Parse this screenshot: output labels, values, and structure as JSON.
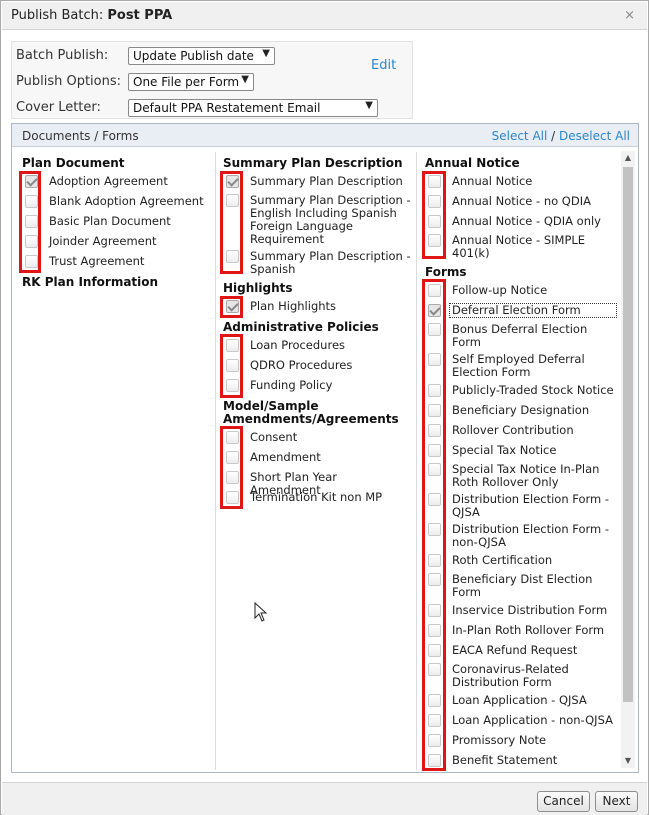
{
  "dialog": {
    "title_prefix": "Publish Batch:",
    "title_name": "Post PPA",
    "close": "×"
  },
  "options": {
    "batch_publish_label": "Batch Publish:",
    "batch_publish_value": "Update Publish date",
    "publish_options_label": "Publish Options:",
    "publish_options_value": "One File per Form",
    "cover_letter_label": "Cover Letter:",
    "cover_letter_value": "Default PPA Restatement Email",
    "edit_label": "Edit"
  },
  "panel": {
    "title": "Documents / Forms",
    "select_all": "Select All",
    "separator": "/",
    "deselect_all": "Deselect All"
  },
  "col1": {
    "plan_document": "Plan Document",
    "items": [
      {
        "label": "Adoption Agreement",
        "checked": true
      },
      {
        "label": "Blank Adoption Agreement",
        "checked": false
      },
      {
        "label": "Basic Plan Document",
        "checked": false
      },
      {
        "label": "Joinder Agreement",
        "checked": false
      },
      {
        "label": "Trust Agreement",
        "checked": false
      }
    ],
    "rk_plan_info": "RK Plan Information"
  },
  "col2": {
    "spd": "Summary Plan Description",
    "spd_items": [
      {
        "label": "Summary Plan Description",
        "checked": true
      },
      {
        "label": "Summary Plan Description - English Including Spanish Foreign Language Requirement",
        "checked": false
      },
      {
        "label": "Summary Plan Description - Spanish",
        "checked": false
      }
    ],
    "highlights": "Highlights",
    "highlights_items": [
      {
        "label": "Plan Highlights",
        "checked": true
      }
    ],
    "admin": "Administrative Policies",
    "admin_items": [
      {
        "label": "Loan Procedures",
        "checked": false
      },
      {
        "label": "QDRO Procedures",
        "checked": false
      },
      {
        "label": "Funding Policy",
        "checked": false
      }
    ],
    "model": "Model/Sample Amendments/Agreements",
    "model_items": [
      {
        "label": "Consent",
        "checked": false
      },
      {
        "label": "Amendment",
        "checked": false
      },
      {
        "label": "Short Plan Year Amendment",
        "checked": false
      },
      {
        "label": "Termination Kit non MP",
        "checked": false
      }
    ]
  },
  "col3": {
    "annual": "Annual Notice",
    "annual_items": [
      {
        "label": "Annual Notice",
        "checked": false
      },
      {
        "label": "Annual Notice - no QDIA",
        "checked": false
      },
      {
        "label": "Annual Notice - QDIA only",
        "checked": false
      },
      {
        "label": "Annual Notice - SIMPLE 401(k)",
        "checked": false
      }
    ],
    "forms": "Forms",
    "forms_items": [
      {
        "label": "Follow-up Notice",
        "checked": false
      },
      {
        "label": "Deferral Election Form",
        "checked": true
      },
      {
        "label": "Bonus Deferral Election Form",
        "checked": false
      },
      {
        "label": "Self Employed Deferral Election Form",
        "checked": false
      },
      {
        "label": "Publicly-Traded Stock Notice",
        "checked": false
      },
      {
        "label": "Beneficiary Designation",
        "checked": false
      },
      {
        "label": "Rollover Contribution",
        "checked": false
      },
      {
        "label": "Special Tax Notice",
        "checked": false
      },
      {
        "label": "Special Tax Notice In-Plan Roth Rollover Only",
        "checked": false
      },
      {
        "label": "Distribution Election Form - QJSA",
        "checked": false
      },
      {
        "label": "Distribution Election Form - non-QJSA",
        "checked": false
      },
      {
        "label": "Roth Certification",
        "checked": false
      },
      {
        "label": "Beneficiary Dist Election Form",
        "checked": false
      },
      {
        "label": "Inservice Distribution Form",
        "checked": false
      },
      {
        "label": "In-Plan Roth Rollover Form",
        "checked": false
      },
      {
        "label": "EACA Refund Request",
        "checked": false
      },
      {
        "label": "Coronavirus-Related Distribution Form",
        "checked": false
      },
      {
        "label": "Loan Application - QJSA",
        "checked": false
      },
      {
        "label": "Loan Application - non-QJSA",
        "checked": false
      },
      {
        "label": "Promissory Note",
        "checked": false
      },
      {
        "label": "Benefit Statement",
        "checked": false
      }
    ]
  },
  "scroll": {
    "up": "▲",
    "down": "▼"
  },
  "footer": {
    "cancel": "Cancel",
    "next": "Next"
  },
  "colors": {
    "highlight_box": "#e01515",
    "link": "#2a86c8"
  }
}
